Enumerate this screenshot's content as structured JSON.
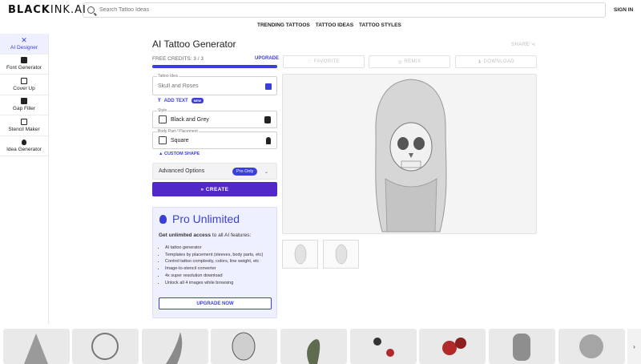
{
  "header": {
    "logo_bold": "BLACK",
    "logo_light": "INK.AI",
    "search_placeholder": "Search Tattoo Ideas",
    "signin": "SIGN IN"
  },
  "nav": [
    "TRENDING TATTOOS",
    "TATTOO IDEAS",
    "TATTOO STYLES"
  ],
  "sidebar": [
    {
      "label": "AI Designer",
      "icon": "wand-icon",
      "active": true
    },
    {
      "label": "Font Generator",
      "icon": "font-icon"
    },
    {
      "label": "Cover Up",
      "icon": "layers-icon"
    },
    {
      "label": "Gap Filler",
      "icon": "brush-icon"
    },
    {
      "label": "Stencil Maker",
      "icon": "stencil-icon"
    },
    {
      "label": "Idea Generator",
      "icon": "bulb-icon"
    }
  ],
  "main": {
    "title": "AI Tattoo Generator",
    "share": "SHARE",
    "credits_label": "FREE CREDITS: 3 / 3",
    "credits_fraction": 1.0,
    "upgrade_link": "UPGRADE",
    "idea_label": "Tattoo Idea",
    "idea_placeholder": "Skull and Roses",
    "add_text": "ADD TEXT",
    "new_badge": "NEW",
    "style_label": "Style",
    "style_value": "Black and Grey",
    "placement_label": "Body Part / Placement",
    "placement_value": "Square",
    "custom_shape": "CUSTOM SHAPE",
    "advanced": "Advanced Options",
    "pro_only": "Pro Only",
    "create": "CREATE"
  },
  "pro": {
    "title": "Pro Unlimited",
    "sub_bold": "Get unlimited access",
    "sub_rest": " to all AI features:",
    "features": [
      "AI tattoo generator",
      "Templates by placement (sleeves, body parts, etc)",
      "Control tattoo complexity, colors, line weight, etc",
      "Image-to-stencil converter",
      "4x super resolution download",
      "Unlock all 4 images while browsing"
    ],
    "button": "UPGRADE NOW"
  },
  "actions": {
    "favorite": "FAVORITE",
    "remix": "REMIX",
    "download": "DOWNLOAD"
  },
  "colors": {
    "accent": "#3a3fd8",
    "create_button": "#5228c9"
  }
}
